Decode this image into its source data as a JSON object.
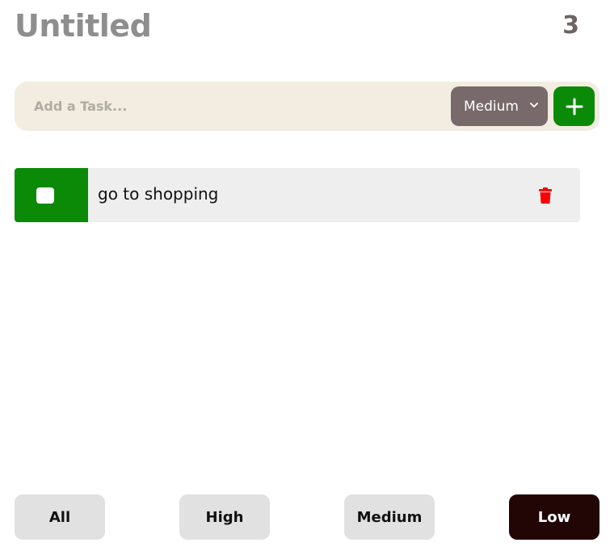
{
  "header": {
    "title": "Untitled",
    "count": "3"
  },
  "add_task": {
    "placeholder": "Add a Task...",
    "priority_selected": "Medium",
    "add_icon": "plus-icon",
    "add_button_color": "#0b8a08"
  },
  "tasks": [
    {
      "text": "go to shopping",
      "checked": false,
      "delete_icon": "trash-icon",
      "accent_color": "#0b8a08"
    }
  ],
  "filters": {
    "all": "All",
    "high": "High",
    "medium": "Medium",
    "low": "Low",
    "active": "Low"
  },
  "colors": {
    "title": "#8e8e8e",
    "count": "#6e6363",
    "input_bar": "#f2ede0",
    "select": "#786a6a",
    "delete": "#ff0000",
    "filter_active": "#220606",
    "filter_inactive": "#e1e1e1"
  }
}
